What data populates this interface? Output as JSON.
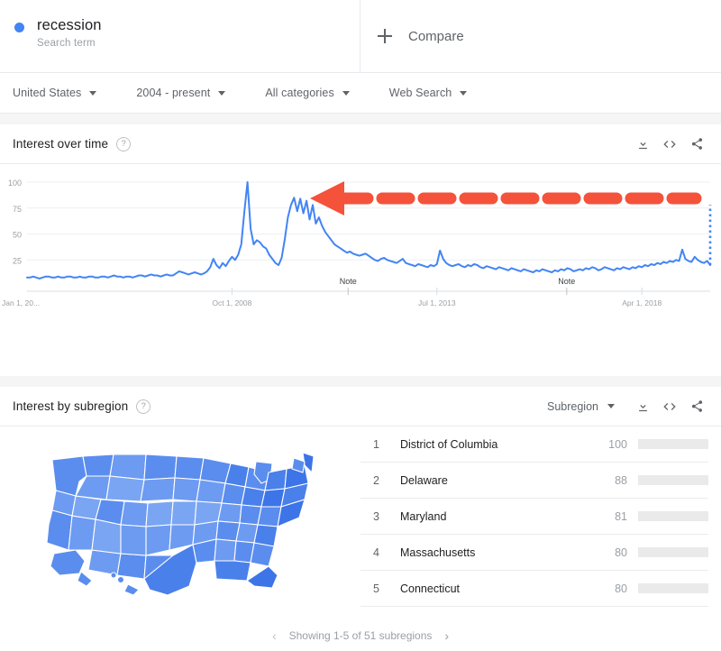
{
  "term": {
    "title": "recession",
    "subtitle": "Search term",
    "dot_color": "#4285f4"
  },
  "compare": {
    "label": "Compare",
    "icon": "plus-icon"
  },
  "filters": [
    {
      "label": "United States"
    },
    {
      "label": "2004 - present"
    },
    {
      "label": "All categories"
    },
    {
      "label": "Web Search"
    }
  ],
  "interest_over_time": {
    "title": "Interest over time",
    "help": "?",
    "actions": [
      {
        "icon": "download-icon"
      },
      {
        "icon": "embed-code-icon"
      },
      {
        "icon": "share-icon"
      }
    ]
  },
  "interest_by_subregion": {
    "title": "Interest by subregion",
    "help": "?",
    "selector": "Subregion",
    "actions": [
      {
        "icon": "download-icon"
      },
      {
        "icon": "embed-code-icon"
      },
      {
        "icon": "share-icon"
      }
    ],
    "rows": [
      {
        "rank": "1",
        "name": "District of Columbia",
        "value": "100",
        "pct": 100
      },
      {
        "rank": "2",
        "name": "Delaware",
        "value": "88",
        "pct": 88
      },
      {
        "rank": "3",
        "name": "Maryland",
        "value": "81",
        "pct": 81
      },
      {
        "rank": "4",
        "name": "Massachusetts",
        "value": "80",
        "pct": 80
      },
      {
        "rank": "5",
        "name": "Connecticut",
        "value": "80",
        "pct": 80
      }
    ],
    "pagination": {
      "text": "Showing 1-5 of 51 subregions",
      "prev": "‹",
      "next": "›"
    }
  },
  "annotation": {
    "type": "arrow",
    "color": "#f4523b",
    "direction": "left",
    "note_labels": [
      "Note",
      "Note"
    ]
  },
  "chart_data": {
    "type": "line",
    "title": "Interest over time",
    "xlabel": "",
    "ylabel": "",
    "ylim": [
      0,
      100
    ],
    "grid": true,
    "line_color": "#4285f4",
    "tick_labels_y": [
      "100",
      "75",
      "50",
      "25"
    ],
    "tick_values_y": [
      100,
      75,
      50,
      25
    ],
    "tick_labels_x": [
      "Jan 1, 20...",
      "Oct 1, 2008",
      "Jul 1, 2013",
      "Apr 1, 2018"
    ],
    "tick_positions_x": [
      0,
      0.3,
      0.6,
      0.9
    ],
    "notes": [
      {
        "label": "Note",
        "x": 0.47
      },
      {
        "label": "Note",
        "x": 0.79
      }
    ],
    "partial_data": {
      "from": 20,
      "to": 78,
      "style": "dotted",
      "color": "#4285f4"
    },
    "series": [
      {
        "name": "recession",
        "values": [
          8,
          8,
          9,
          8,
          7,
          8,
          9,
          9,
          8,
          8,
          9,
          8,
          8,
          9,
          9,
          8,
          8,
          9,
          8,
          8,
          9,
          9,
          8,
          8,
          9,
          9,
          8,
          9,
          10,
          9,
          9,
          8,
          9,
          9,
          8,
          9,
          10,
          10,
          9,
          10,
          11,
          10,
          10,
          9,
          10,
          11,
          10,
          10,
          12,
          14,
          13,
          12,
          11,
          12,
          13,
          12,
          11,
          12,
          14,
          18,
          26,
          20,
          17,
          22,
          19,
          24,
          28,
          25,
          30,
          40,
          72,
          100,
          55,
          40,
          44,
          42,
          38,
          36,
          30,
          26,
          22,
          20,
          27,
          45,
          66,
          78,
          85,
          72,
          84,
          70,
          82,
          64,
          78,
          60,
          66,
          58,
          52,
          48,
          44,
          40,
          38,
          36,
          34,
          32,
          33,
          31,
          30,
          29,
          30,
          31,
          29,
          27,
          25,
          24,
          26,
          27,
          25,
          24,
          23,
          22,
          24,
          26,
          22,
          21,
          20,
          19,
          21,
          20,
          19,
          18,
          20,
          19,
          21,
          34,
          26,
          22,
          20,
          19,
          20,
          21,
          19,
          18,
          20,
          19,
          21,
          20,
          18,
          17,
          19,
          18,
          17,
          16,
          18,
          17,
          16,
          15,
          17,
          16,
          15,
          14,
          16,
          15,
          14,
          13,
          15,
          14,
          16,
          15,
          14,
          13,
          15,
          14,
          16,
          15,
          17,
          16,
          14,
          15,
          16,
          15,
          17,
          16,
          18,
          17,
          15,
          16,
          18,
          17,
          16,
          15,
          17,
          16,
          18,
          17,
          16,
          18,
          17,
          19,
          18,
          20,
          19,
          21,
          20,
          22,
          21,
          23,
          22,
          24,
          23,
          25,
          24,
          35,
          26,
          24,
          23,
          28,
          25,
          23,
          22,
          24,
          20
        ]
      }
    ]
  }
}
